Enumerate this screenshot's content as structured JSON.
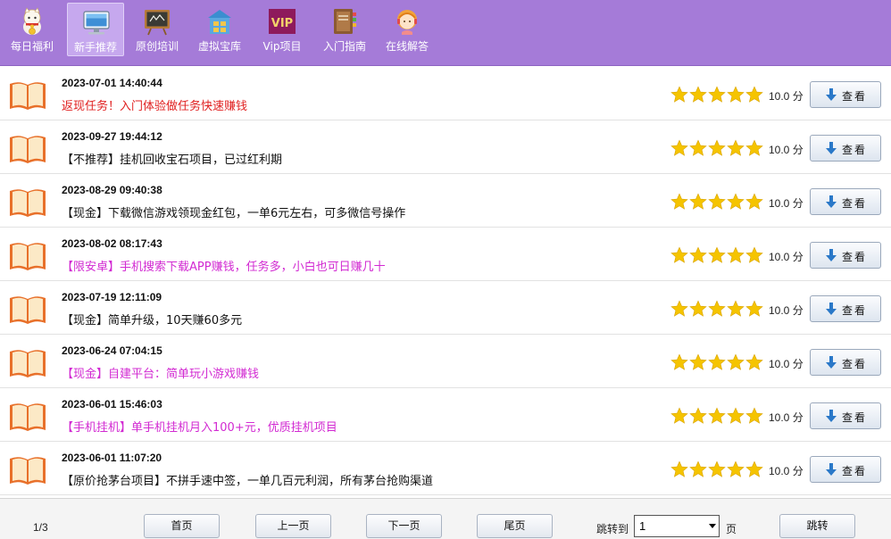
{
  "toolbar": {
    "items": [
      {
        "label": "每日福利",
        "icon": "lucky-cat-icon"
      },
      {
        "label": "新手推荐",
        "icon": "computer-icon",
        "active": true
      },
      {
        "label": "原创培训",
        "icon": "blackboard-icon"
      },
      {
        "label": "虚拟宝库",
        "icon": "treasure-house-icon"
      },
      {
        "label": "Vip项目",
        "icon": "vip-icon",
        "badge": "VIP"
      },
      {
        "label": "入门指南",
        "icon": "guide-book-icon"
      },
      {
        "label": "在线解答",
        "icon": "support-agent-icon"
      }
    ]
  },
  "items": [
    {
      "date": "2023-07-01 14:40:44",
      "title": "返现任务！入门体验做任务快速赚钱",
      "color": "#e02020",
      "rating": 5,
      "score": "10.0 分"
    },
    {
      "date": "2023-09-27 19:44:12",
      "title": "【不推荐】挂机回收宝石项目，已过红利期",
      "color": "#111111",
      "rating": 5,
      "score": "10.0 分"
    },
    {
      "date": "2023-08-29 09:40:38",
      "title": "【现金】下载微信游戏领现金红包，一单6元左右，可多微信号操作",
      "color": "#111111",
      "rating": 5,
      "score": "10.0 分"
    },
    {
      "date": "2023-08-02 08:17:43",
      "title": "【限安卓】手机搜索下载APP赚钱，任务多，小白也可日赚几十",
      "color": "#d22ad2",
      "rating": 5,
      "score": "10.0 分"
    },
    {
      "date": "2023-07-19 12:11:09",
      "title": "【现金】简单升级，10天赚60多元",
      "color": "#111111",
      "rating": 5,
      "score": "10.0 分"
    },
    {
      "date": "2023-06-24 07:04:15",
      "title": "【现金】自建平台：简单玩小游戏赚钱",
      "color": "#d22ad2",
      "rating": 5,
      "score": "10.0 分"
    },
    {
      "date": "2023-06-01 15:46:03",
      "title": "【手机挂机】单手机挂机月入100+元，优质挂机项目",
      "color": "#d22ad2",
      "rating": 5,
      "score": "10.0 分"
    },
    {
      "date": "2023-06-01 11:07:20",
      "title": "【原价抢茅台项目】不拼手速中签，一单几百元利润，所有茅台抢购渠道",
      "color": "#111111",
      "rating": 5,
      "score": "10.0 分"
    }
  ],
  "view_button_label": "查看",
  "footer": {
    "page_info": "1/3",
    "first": "首页",
    "prev": "上一页",
    "next": "下一页",
    "last": "尾页",
    "jump_label": "跳转到",
    "jump_value": "1",
    "page_label": "页",
    "go": "跳转"
  },
  "colors": {
    "toolbar_bg": "#a57bd8",
    "star": "#f5c400",
    "book_orange": "#e8702a"
  }
}
